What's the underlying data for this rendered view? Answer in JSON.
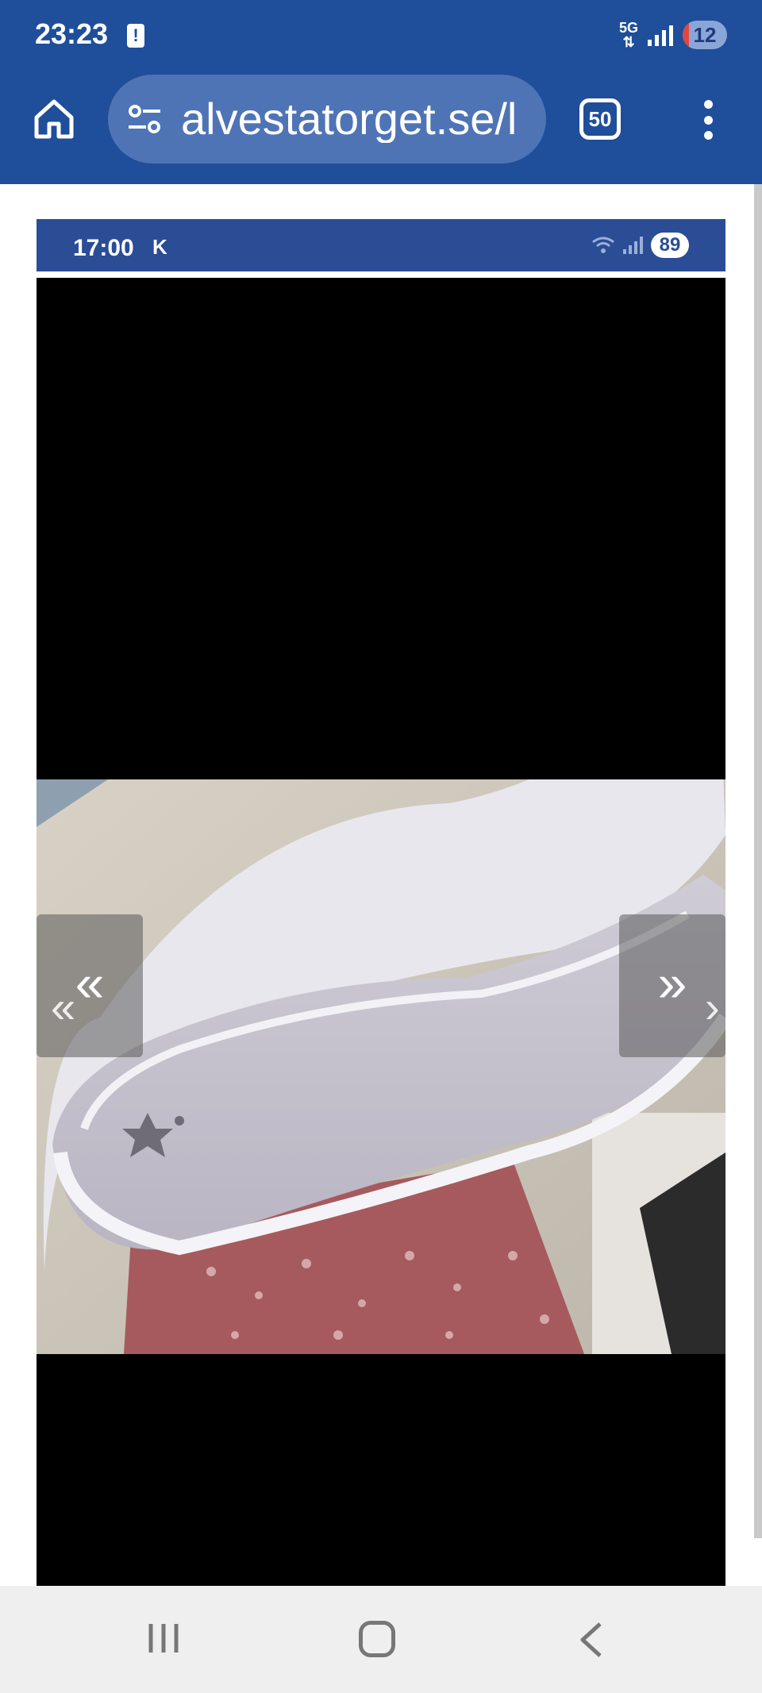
{
  "status_bar": {
    "time": "23:23",
    "network": "5G",
    "battery": "12"
  },
  "browser": {
    "url": "alvestatorget.se/l",
    "tab_count": "50"
  },
  "embedded_screenshot": {
    "time": "17:00",
    "indicator": "K",
    "battery": "89"
  },
  "gallery": {
    "prev_label": "«",
    "next_label": "»",
    "ghost_prev_label": "«",
    "ghost_next_label": "›"
  },
  "icons": {
    "home": "home-icon",
    "site_settings": "tune-icon",
    "menu": "more-vert-icon",
    "recents": "recents-icon",
    "nav_home": "home-circle-icon",
    "back": "back-icon"
  },
  "colors": {
    "chrome": "#1f4e9a",
    "url_bar": "#4f74b6",
    "nav_bar": "#efefef"
  }
}
